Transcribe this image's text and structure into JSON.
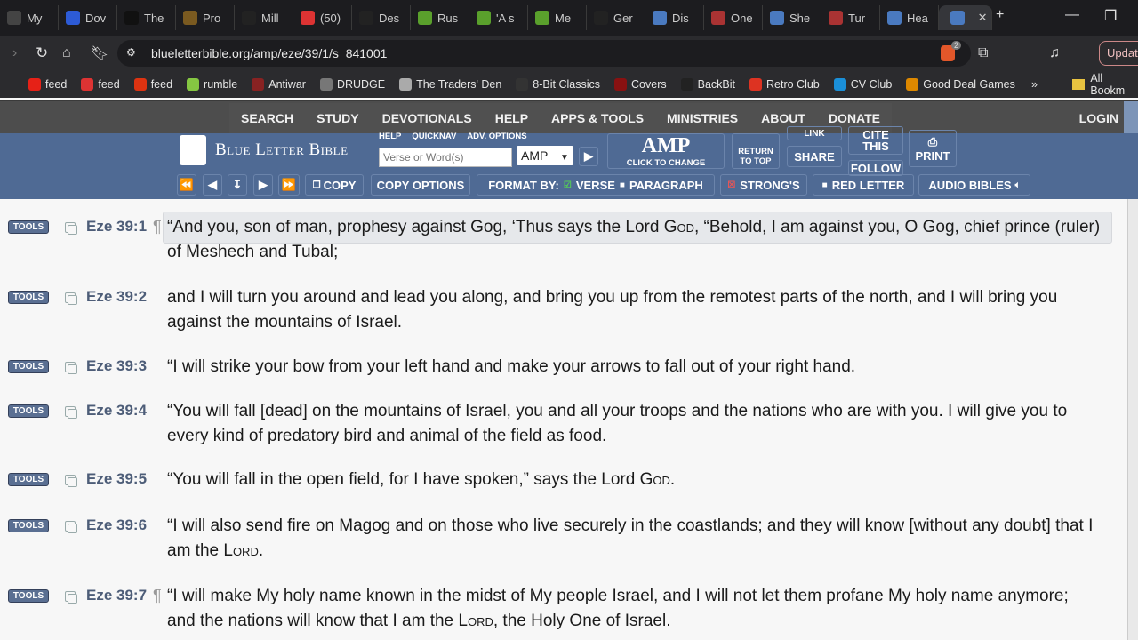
{
  "browser": {
    "tabs": [
      "My",
      "Dov",
      "The",
      "Pro",
      "Mill",
      "(50)",
      "Des",
      "Rus",
      "'A s",
      "Me",
      "Ger",
      "Dis",
      "One",
      "She",
      "Tur",
      "Hea"
    ],
    "tab_colors": [
      "#444",
      "#2d5bd6",
      "#111",
      "#7a5a20",
      "#222",
      "#d33",
      "#222",
      "#5aa02c",
      "#5aa02c",
      "#5aa02c",
      "#222",
      "#4a7ac0",
      "#a33",
      "#4a7ac0",
      "#a33",
      "#4a7ac0"
    ],
    "url": "blueletterbible.org/amp/eze/39/1/s_841001",
    "shield_badge": "2",
    "update_label": "Update",
    "bookmarks": [
      {
        "label": "feed",
        "color": "#e62117"
      },
      {
        "label": "feed",
        "color": "#d33"
      },
      {
        "label": "feed",
        "color": "#d31"
      },
      {
        "label": "rumble",
        "color": "#85c742"
      },
      {
        "label": "Antiwar",
        "color": "#822"
      },
      {
        "label": "DRUDGE",
        "color": "#777"
      },
      {
        "label": "The Traders' Den",
        "color": "#aaa"
      },
      {
        "label": "8-Bit Classics",
        "color": "#333"
      },
      {
        "label": "Covers",
        "color": "#811"
      },
      {
        "label": "BackBit",
        "color": "#222"
      },
      {
        "label": "Retro Club",
        "color": "#d32"
      },
      {
        "label": "CV Club",
        "color": "#1a8fd8"
      },
      {
        "label": "Good Deal Games",
        "color": "#d80"
      }
    ],
    "all_bookmarks": "All Bookm"
  },
  "site": {
    "nav": [
      "SEARCH",
      "STUDY",
      "DEVOTIONALS",
      "HELP",
      "APPS & TOOLS",
      "MINISTRIES",
      "ABOUT",
      "DONATE"
    ],
    "login": "LOGIN",
    "logo": "Blue Letter Bible",
    "search_links": [
      "HELP",
      "QUICKNAV",
      "ADV. OPTIONS"
    ],
    "search_placeholder": "Verse or Word(s)",
    "version_select": "AMP",
    "version_big": "AMP",
    "click_to_change": "CLICK TO CHANGE",
    "return_to_top": "RETURN TO TOP",
    "link": "LINK",
    "share": "SHARE",
    "cite": "CITE THIS",
    "follow": "FOLLOW",
    "print": "PRINT",
    "toolbar": {
      "copy": "COPY",
      "copy_options": "COPY OPTIONS",
      "format_by": "FORMAT BY:",
      "verse": "VERSE",
      "paragraph": "PARAGRAPH",
      "strongs": "STRONG'S",
      "red_letter": "RED LETTER",
      "audio": "AUDIO BIBLES"
    }
  },
  "tools_label": "TOOLS",
  "verses": [
    {
      "ref": "Eze 39:1",
      "para": true,
      "highlight": true,
      "html": "“And you, son of man, prophesy against Gog, ‘Thus says the Lord G<span class=\"sc\">od</span>, “Behold, I am against you, O Gog, chief prince (ruler) of Meshech and Tubal;"
    },
    {
      "ref": "Eze 39:2",
      "para": false,
      "html": "and I will turn you around and lead you along, and bring you up from the remotest parts of the north, and I will bring you against the mountains of Israel."
    },
    {
      "ref": "Eze 39:3",
      "para": false,
      "html": "“I will strike your bow from your left hand and make your arrows to fall out of your right hand."
    },
    {
      "ref": "Eze 39:4",
      "para": false,
      "html": "“You will fall [dead] on the mountains of Israel, you and all your troops and the nations who are with you. I will give you to every kind of predatory bird and animal of the field as food."
    },
    {
      "ref": "Eze 39:5",
      "para": false,
      "html": "“You will fall in the open field, for I have spoken,” says the Lord G<span class=\"sc\">od</span>."
    },
    {
      "ref": "Eze 39:6",
      "para": false,
      "html": "“I will also send fire on Magog and on those who live securely in the coastlands; and they will know [without any doubt] that I am the L<span class=\"sc\">ord</span>."
    },
    {
      "ref": "Eze 39:7",
      "para": true,
      "html": "“I will make My holy name known in the midst of My people Israel, and I will not let them profane My holy name anymore; and the nations will know that I am the L<span class=\"sc\">ord</span>, the Holy One of Israel."
    }
  ]
}
